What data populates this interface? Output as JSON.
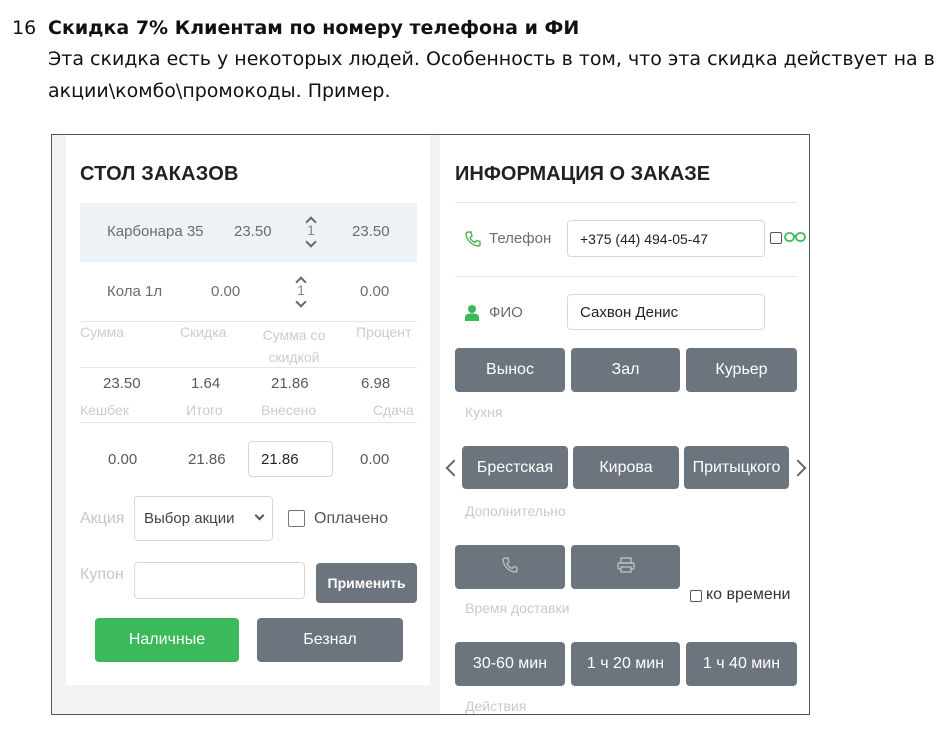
{
  "doc": {
    "number": "16",
    "title": "Скидка 7% Клиентам по номеру телефона и ФИ",
    "line1": "Эта скидка есть у некоторых людей. Особенность в том, что эта скидка действует на все",
    "line2": "акции\\комбо\\промокоды. Пример."
  },
  "order_table": {
    "title": "СТОЛ ЗАКАЗОВ",
    "items": [
      {
        "name": "Карбонара 35",
        "price": "23.50",
        "qty": "1",
        "total": "23.50",
        "selected": true
      },
      {
        "name": "Кола 1л",
        "price": "0.00",
        "qty": "1",
        "total": "0.00",
        "selected": false
      }
    ],
    "summary_headers": [
      "Сумма",
      "Скидка",
      "Сумма со скидкой",
      "Процент"
    ],
    "summary_values": [
      "23.50",
      "1.64",
      "21.86",
      "6.98"
    ],
    "payment_headers": [
      "Кешбек",
      "Итого",
      "Внесено",
      "Сдача"
    ],
    "payment_values": {
      "cashback": "0.00",
      "total": "21.86",
      "paid_input": "21.86",
      "change": "0.00"
    },
    "promo_label": "Акция",
    "promo_select": "Выбор акции",
    "paid_label": "Оплачено",
    "paid_checked": false,
    "coupon_label": "Купон",
    "coupon_value": "",
    "apply_button": "Применить",
    "cash_button": "Наличные",
    "card_button": "Безнал"
  },
  "order_info": {
    "title": "ИНФОРМАЦИЯ О ЗАКАЗЕ",
    "phone_label": "Телефон",
    "phone_value": "+375 (44) 494-05-47",
    "name_label": "ФИО",
    "name_value": "Сахвон Денис",
    "order_types": [
      "Вынос",
      "Зал",
      "Курьер"
    ],
    "kitchen_label": "Кухня",
    "kitchens": [
      "Брестская",
      "Кирова",
      "Притыцкого"
    ],
    "extra_label": "Дополнительно",
    "on_time_label": "ко времени",
    "delivery_label": "Время доставки",
    "delivery_times": [
      "30-60 мин",
      "1 ч 20 мин",
      "1 ч 40 мин"
    ],
    "actions_label": "Действия"
  },
  "colors": {
    "green": "#3cb95a",
    "grey_button": "#6c757d",
    "phone_icon": "#4caf50"
  },
  "icons": [
    "phone-icon",
    "user-icon",
    "glasses-icon",
    "printer-icon",
    "chevron-left-icon",
    "chevron-right-icon"
  ]
}
